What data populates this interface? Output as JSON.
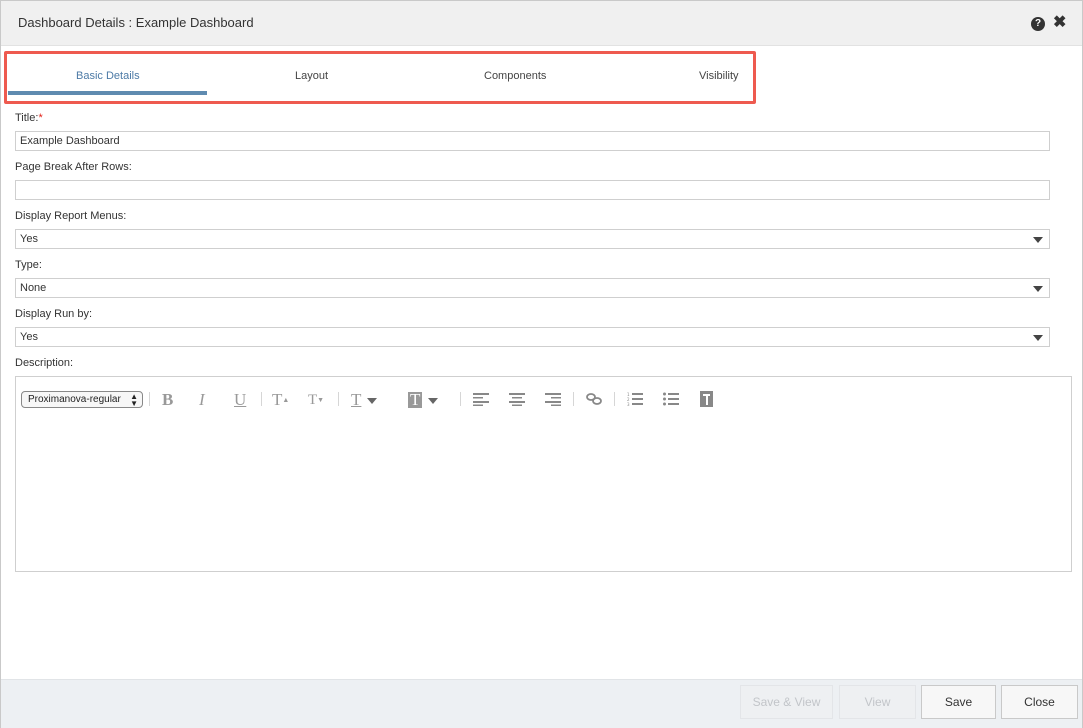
{
  "dialog": {
    "title": "Dashboard Details : Example Dashboard",
    "help_icon": "?",
    "close_icon": "✖"
  },
  "tabs": [
    {
      "label": "Basic Details",
      "active": true
    },
    {
      "label": "Layout",
      "active": false
    },
    {
      "label": "Components",
      "active": false
    },
    {
      "label": "Visibility",
      "active": false
    }
  ],
  "form": {
    "title_label": "Title:",
    "title_required": "*",
    "title_value": "Example Dashboard",
    "page_break_label": "Page Break After Rows:",
    "page_break_value": "",
    "display_report_menus_label": "Display Report Menus:",
    "display_report_menus_value": "Yes",
    "type_label": "Type:",
    "type_value": "None",
    "display_run_by_label": "Display Run by:",
    "display_run_by_value": "Yes",
    "description_label": "Description:"
  },
  "editor": {
    "font_select_value": "Proximanova-regular",
    "toolbar_icons": [
      "bold-icon",
      "italic-icon",
      "underline-icon",
      "superscript-icon",
      "subscript-icon",
      "text-color-icon",
      "highlight-color-icon",
      "align-left-icon",
      "align-center-icon",
      "align-right-icon",
      "link-icon",
      "ordered-list-icon",
      "unordered-list-icon",
      "paragraph-icon"
    ]
  },
  "footer": {
    "save_view_label": "Save & View",
    "view_label": "View",
    "save_label": "Save",
    "close_label": "Close"
  },
  "colors": {
    "accent_tab": "#4c7aa6",
    "highlight_box": "#ee5a4f",
    "required": "#e2231a"
  }
}
